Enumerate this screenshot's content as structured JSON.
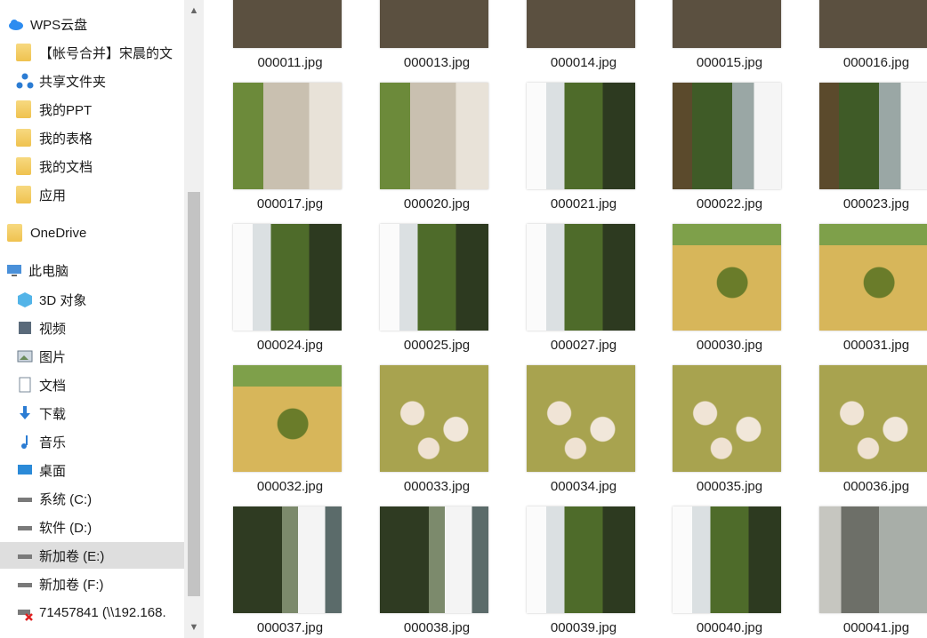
{
  "sidebar": {
    "items": [
      {
        "label": "WPS云盘",
        "icon": "cloud-icon"
      },
      {
        "label": "【帐号合并】宋晨的文",
        "icon": "folder-icon"
      },
      {
        "label": "共享文件夹",
        "icon": "share-icon"
      },
      {
        "label": "我的PPT",
        "icon": "folder-icon"
      },
      {
        "label": "我的表格",
        "icon": "folder-icon"
      },
      {
        "label": "我的文档",
        "icon": "folder-icon"
      },
      {
        "label": "应用",
        "icon": "folder-icon"
      },
      {
        "label": "OneDrive",
        "icon": "folder-icon"
      },
      {
        "label": "此电脑",
        "icon": "computer-icon"
      },
      {
        "label": "3D 对象",
        "icon": "cube-icon"
      },
      {
        "label": "视频",
        "icon": "video-icon"
      },
      {
        "label": "图片",
        "icon": "image-icon"
      },
      {
        "label": "文档",
        "icon": "document-icon"
      },
      {
        "label": "下载",
        "icon": "download-icon"
      },
      {
        "label": "音乐",
        "icon": "music-icon"
      },
      {
        "label": "桌面",
        "icon": "desktop-icon"
      },
      {
        "label": "系统 (C:)",
        "icon": "drive-icon"
      },
      {
        "label": "软件 (D:)",
        "icon": "drive-icon"
      },
      {
        "label": "新加卷 (E:)",
        "icon": "drive-icon"
      },
      {
        "label": "新加卷 (F:)",
        "icon": "drive-icon"
      },
      {
        "label": "71457841 (\\\\192.168.",
        "icon": "network-drive-icon"
      }
    ],
    "selected_index": 18
  },
  "files": [
    {
      "name": "000011.jpg",
      "style": "t-bridge"
    },
    {
      "name": "000013.jpg",
      "style": "t-bridge"
    },
    {
      "name": "000014.jpg",
      "style": "t-bridge"
    },
    {
      "name": "000015.jpg",
      "style": "t-bridge"
    },
    {
      "name": "000016.jpg",
      "style": "t-bridge"
    },
    {
      "name": "000017.jpg",
      "style": "t-road"
    },
    {
      "name": "000020.jpg",
      "style": "t-road"
    },
    {
      "name": "000021.jpg",
      "style": "t-river1"
    },
    {
      "name": "000022.jpg",
      "style": "t-river2"
    },
    {
      "name": "000023.jpg",
      "style": "t-river2"
    },
    {
      "name": "000024.jpg",
      "style": "t-river1"
    },
    {
      "name": "000025.jpg",
      "style": "t-river1"
    },
    {
      "name": "000027.jpg",
      "style": "t-river1"
    },
    {
      "name": "000030.jpg",
      "style": "t-sand"
    },
    {
      "name": "000031.jpg",
      "style": "t-sand"
    },
    {
      "name": "000032.jpg",
      "style": "t-sand"
    },
    {
      "name": "000033.jpg",
      "style": "t-water"
    },
    {
      "name": "000034.jpg",
      "style": "t-water"
    },
    {
      "name": "000035.jpg",
      "style": "t-water"
    },
    {
      "name": "000036.jpg",
      "style": "t-water"
    },
    {
      "name": "000037.jpg",
      "style": "t-dark"
    },
    {
      "name": "000038.jpg",
      "style": "t-dark"
    },
    {
      "name": "000039.jpg",
      "style": "t-river1"
    },
    {
      "name": "000040.jpg",
      "style": "t-river1"
    },
    {
      "name": "000041.jpg",
      "style": "t-pale"
    }
  ],
  "colors": {
    "selected_bg": "#dedede",
    "folder": "#efc24f",
    "accent": "#1e88e5"
  }
}
